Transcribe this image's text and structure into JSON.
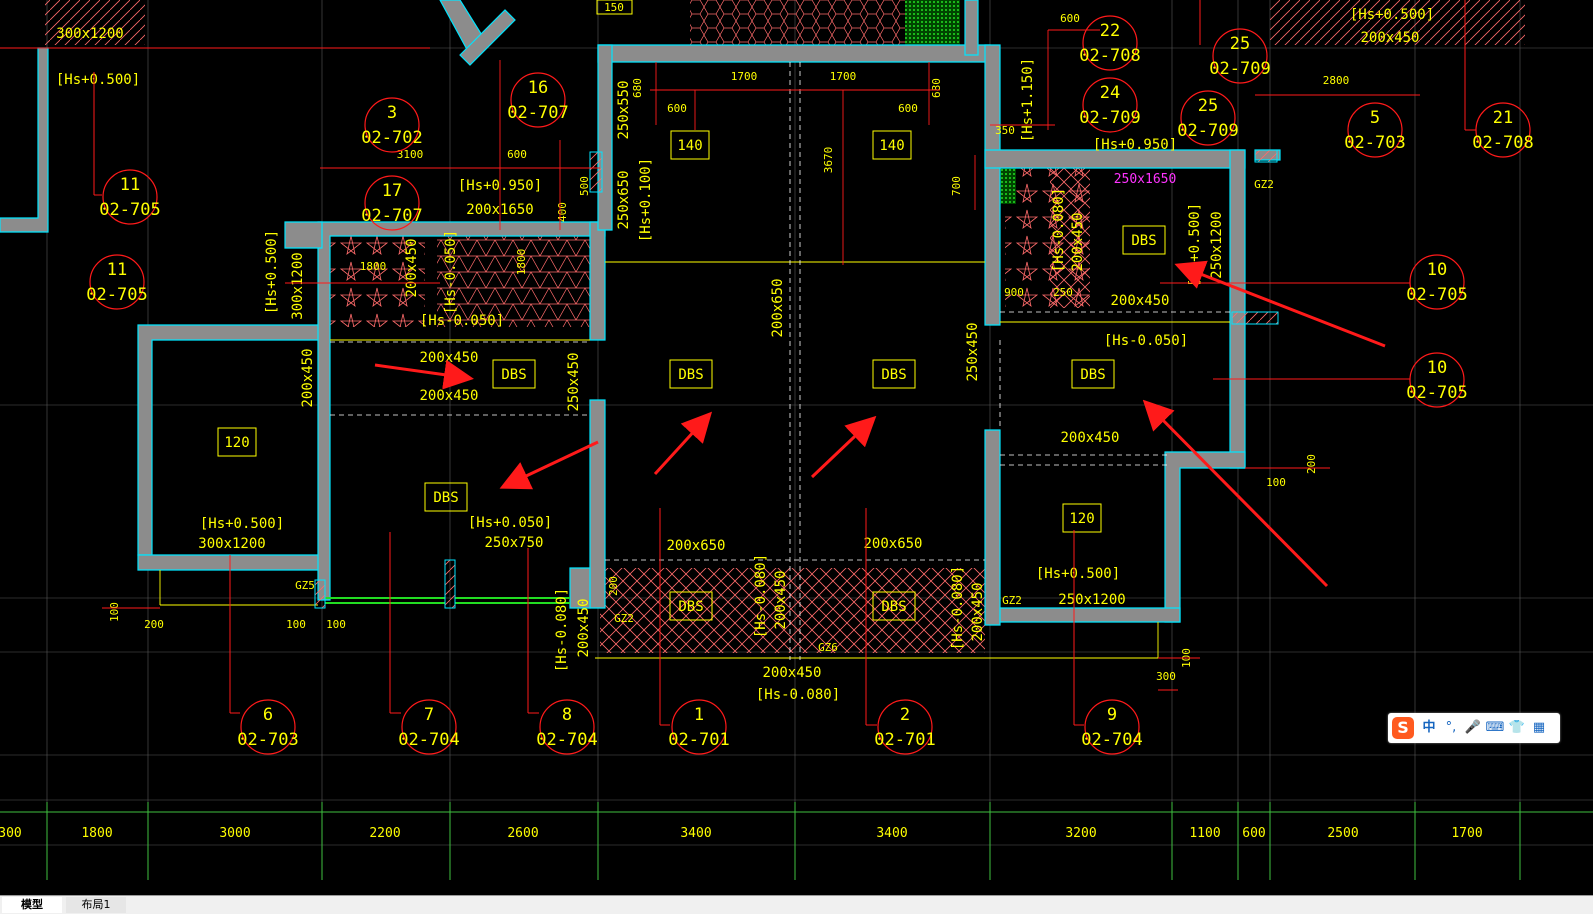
{
  "colors": {
    "background": "#000000",
    "wall": "#8c8c8c",
    "wall_edge": "#00e5ff",
    "annotation": "#ffff00",
    "callout": "#ff1a1a",
    "grid": "#6b6b6b",
    "dim_line": "#3fbf3f",
    "magenta": "#ff33ff",
    "hatch": "#ff6b6b",
    "arrow": "#ff1a1a"
  },
  "tabs": [
    {
      "label": "模型",
      "active": true
    },
    {
      "label": "布局1",
      "active": false
    }
  ],
  "ime": {
    "logo": "S",
    "lang": "中",
    "punct": "°,",
    "mic_icon": "🎤",
    "keyboard_icon": "⌨",
    "skin_icon": "👕",
    "apps_icon": "▦"
  },
  "rooms": [
    {
      "id": "r120a",
      "label": "120"
    },
    {
      "id": "r120b",
      "label": "120"
    },
    {
      "id": "r140a",
      "label": "140"
    },
    {
      "id": "r140b",
      "label": "140"
    },
    {
      "id": "dbs1",
      "label": "DBS"
    },
    {
      "id": "dbs2",
      "label": "DBS"
    },
    {
      "id": "dbs3",
      "label": "DBS"
    },
    {
      "id": "dbs4",
      "label": "DBS"
    },
    {
      "id": "dbs5",
      "label": "DBS"
    },
    {
      "id": "dbs6",
      "label": "DBS"
    },
    {
      "id": "dbs7",
      "label": "DBS"
    },
    {
      "id": "dbs8",
      "label": "DBS"
    },
    {
      "id": "r150",
      "label": "150"
    }
  ],
  "annotations": [
    "[Hs+0.500]",
    "[Hs+0.950]",
    "200x1650",
    "[Hs+0.500]",
    "300x1200",
    "[Hs-0.050]",
    "200x450",
    "200x450",
    "200x450",
    "250x450",
    "200x650",
    "250x650",
    "[Hs+0.100]",
    "250x550",
    "[Hs+0.500]",
    "300x1200",
    "[Hs+0.050]",
    "250x750",
    "200x650",
    "200x650",
    "200x450",
    "[Hs-0.080]",
    "[Hs-0.080]",
    "200x450",
    "[Hs-0.080]",
    "200x450",
    "[Hs+0.950]",
    "250x1650",
    "[Hs+0.500]",
    "250x1200",
    "200x450",
    "[Hs-0.050]",
    "200x450",
    "250x450",
    "[Hs+0.500]",
    "250x1200",
    "[Hs+1.150]",
    "[Hs-0.080]",
    "200x450",
    "GZ5",
    "GZ2",
    "GZ6",
    "GZ2",
    "GZ2",
    "300x1200",
    "[Hs+0.500]",
    "200x450",
    "[Hs-0.050]",
    "[Hs-0.080]",
    "200x450",
    "200x450"
  ],
  "callouts": [
    {
      "num": "3",
      "ref": "02-702"
    },
    {
      "num": "16",
      "ref": "02-707"
    },
    {
      "num": "11",
      "ref": "02-705"
    },
    {
      "num": "17",
      "ref": "02-707"
    },
    {
      "num": "11",
      "ref": "02-705"
    },
    {
      "num": "22",
      "ref": "02-708"
    },
    {
      "num": "24",
      "ref": "02-709"
    },
    {
      "num": "25",
      "ref": "02-709"
    },
    {
      "num": "25",
      "ref": "02-709"
    },
    {
      "num": "5",
      "ref": "02-703"
    },
    {
      "num": "21",
      "ref": "02-708"
    },
    {
      "num": "10",
      "ref": "02-705"
    },
    {
      "num": "10",
      "ref": "02-705"
    },
    {
      "num": "6",
      "ref": "02-703"
    },
    {
      "num": "7",
      "ref": "02-704"
    },
    {
      "num": "8",
      "ref": "02-704"
    },
    {
      "num": "1",
      "ref": "02-701"
    },
    {
      "num": "2",
      "ref": "02-701"
    },
    {
      "num": "9",
      "ref": "02-704"
    }
  ],
  "dimensions_bottom": [
    "300",
    "1800",
    "3000",
    "2200",
    "2600",
    "3400",
    "3400",
    "3200",
    "1100",
    "600",
    "2500",
    "1700"
  ],
  "dimensions_misc": [
    "1700",
    "1700",
    "600",
    "600",
    "680",
    "680",
    "3100",
    "600",
    "3670",
    "700",
    "350",
    "500",
    "400",
    "1800",
    "1800",
    "900",
    "250",
    "100",
    "200",
    "100",
    "100",
    "200",
    "100",
    "300",
    "100",
    "2800",
    "600",
    "200",
    "3400",
    "450"
  ]
}
